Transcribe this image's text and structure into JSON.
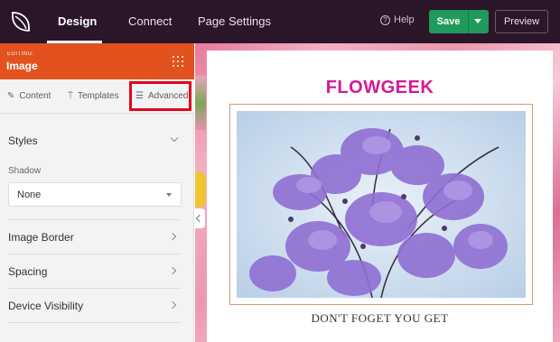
{
  "topbar": {
    "tabs": [
      {
        "label": "Design"
      },
      {
        "label": "Connect"
      },
      {
        "label": "Page Settings"
      }
    ],
    "help_label": "Help",
    "save_label": "Save",
    "preview_label": "Preview"
  },
  "editor": {
    "editing_label": "EDITING:",
    "element_title": "Image",
    "subtabs": [
      {
        "label": "Content",
        "icon": "pencil-icon"
      },
      {
        "label": "Templates",
        "icon": "paint-roller-icon"
      },
      {
        "label": "Advanced",
        "icon": "sliders-icon"
      }
    ],
    "styles_label": "Styles",
    "shadow_label": "Shadow",
    "shadow_value": "None",
    "sections": [
      {
        "label": "Image Border"
      },
      {
        "label": "Spacing"
      },
      {
        "label": "Device Visibility"
      }
    ]
  },
  "preview": {
    "brand": "FLOWGEEK",
    "caption": "DON'T FOGET YOU GET"
  },
  "colors": {
    "topbar": "#2b1629",
    "editing_header": "#e2521f",
    "save": "#1f9a5a",
    "brand": "#d4199a",
    "highlight": "#e0081e"
  }
}
